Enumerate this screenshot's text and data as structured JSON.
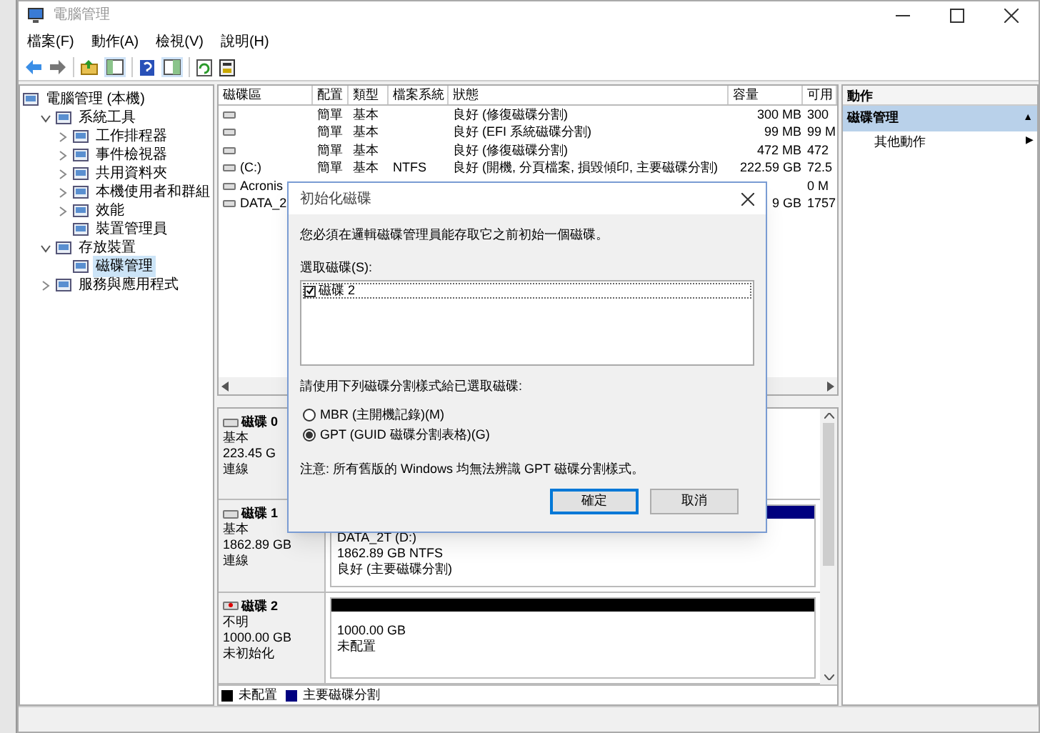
{
  "window": {
    "title": "電腦管理"
  },
  "menu": [
    "檔案(F)",
    "動作(A)",
    "檢視(V)",
    "說明(H)"
  ],
  "tree": [
    {
      "label": "電腦管理 (本機)",
      "selected": false,
      "children": [
        {
          "label": "系統工具",
          "expanded": true,
          "selected": false,
          "children": [
            {
              "label": "工作排程器",
              "expanded": false,
              "selected": false
            },
            {
              "label": "事件檢視器",
              "expanded": false,
              "selected": false
            },
            {
              "label": "共用資料夾",
              "expanded": false,
              "selected": false
            },
            {
              "label": "本機使用者和群組",
              "expanded": false,
              "selected": false
            },
            {
              "label": "效能",
              "expanded": false,
              "selected": false
            },
            {
              "label": "裝置管理員",
              "selected": false
            }
          ]
        },
        {
          "label": "存放裝置",
          "expanded": true,
          "selected": false,
          "children": [
            {
              "label": "磁碟管理",
              "selected": true
            }
          ]
        },
        {
          "label": "服務與應用程式",
          "expanded": false,
          "selected": false
        }
      ]
    }
  ],
  "volumes": {
    "columns": [
      "磁碟區",
      "配置",
      "類型",
      "檔案系統",
      "狀態",
      "容量",
      "可用"
    ],
    "rows": [
      [
        "",
        "簡單",
        "基本",
        "",
        "良好 (修復磁碟分割)",
        "300 MB",
        "300"
      ],
      [
        "",
        "簡單",
        "基本",
        "",
        "良好 (EFI 系統磁碟分割)",
        "99 MB",
        "99 M"
      ],
      [
        "",
        "簡單",
        "基本",
        "",
        "良好 (修復磁碟分割)",
        "472 MB",
        "472"
      ],
      [
        "(C:)",
        "簡單",
        "基本",
        "NTFS",
        "良好 (開機, 分頁檔案, 損毀傾印, 主要磁碟分割)",
        "222.59 GB",
        "72.5"
      ],
      [
        "Acronis",
        "",
        "",
        "",
        "",
        "",
        "0 M"
      ],
      [
        "DATA_2",
        "",
        "",
        "",
        "",
        "9 GB",
        "1757"
      ]
    ]
  },
  "disks": [
    {
      "name": "磁碟 0",
      "kind": "online",
      "lines": [
        "基本",
        "223.45 G",
        "連線"
      ]
    },
    {
      "name": "磁碟 1",
      "kind": "online",
      "lines": [
        "基本",
        "1862.89 GB",
        "連線"
      ],
      "partitions": [
        {
          "color": "#000080",
          "lines": [
            "DATA_2T (D:)",
            "1862.89 GB NTFS",
            "良好 (主要磁碟分割)"
          ]
        }
      ]
    },
    {
      "name": "磁碟 2",
      "kind": "unknown",
      "lines": [
        "不明",
        "1000.00 GB",
        "未初始化"
      ],
      "partitions": [
        {
          "color": "#000000",
          "lines": [
            "1000.00 GB",
            "未配置"
          ]
        }
      ]
    }
  ],
  "legend": [
    {
      "label": "未配置",
      "color": "#000000"
    },
    {
      "label": "主要磁碟分割",
      "color": "#000080"
    }
  ],
  "actions": {
    "header": "動作",
    "items": [
      {
        "label": "磁碟管理",
        "kind": "section",
        "glyph": "▲"
      },
      {
        "label": "其他動作",
        "kind": "item",
        "glyph": "▶"
      }
    ]
  },
  "dialog": {
    "title": "初始化磁碟",
    "message": "您必須在邏輯磁碟管理員能存取它之前初始一個磁碟。",
    "list_label": "選取磁碟(S):",
    "disks": [
      {
        "label": "磁碟 2",
        "checked": true
      }
    ],
    "style_label": "請使用下列磁碟分割樣式給已選取磁碟:",
    "options": [
      {
        "label": "MBR (主開機記錄)(M)",
        "selected": false
      },
      {
        "label": "GPT (GUID 磁碟分割表格)(G)",
        "selected": true
      }
    ],
    "note": "注意: 所有舊版的 Windows 均無法辨識 GPT 磁碟分割樣式。",
    "buttons": [
      {
        "label": "確定",
        "default": true
      },
      {
        "label": "取消",
        "default": false
      }
    ]
  }
}
